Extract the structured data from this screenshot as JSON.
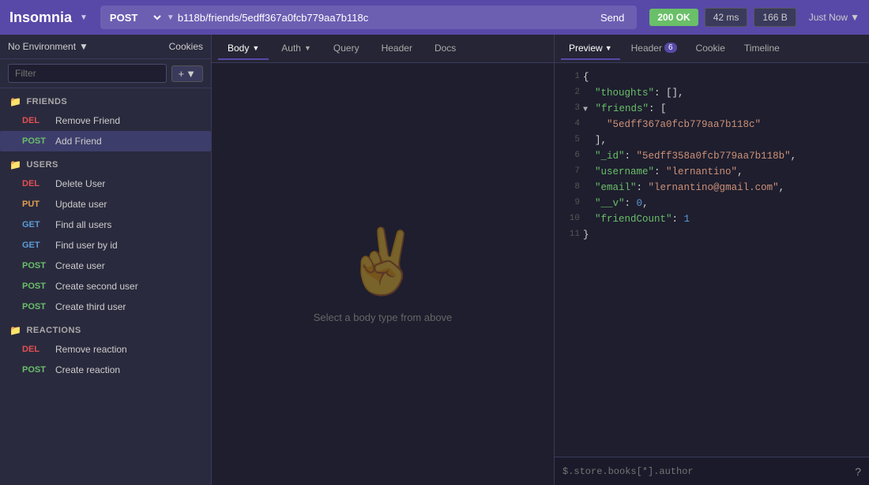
{
  "app": {
    "title": "Insomnia"
  },
  "topbar": {
    "method": "POST",
    "url": "b118b/friends/5edff367a0fcb779aa7b118c",
    "send_label": "Send",
    "status": "200 OK",
    "time": "42 ms",
    "size": "166 B",
    "timestamp": "Just Now"
  },
  "sidebar": {
    "env_label": "No Environment",
    "cookies_label": "Cookies",
    "filter_placeholder": "Filter",
    "add_label": "+",
    "groups": [
      {
        "name": "FRIENDS",
        "items": [
          {
            "method": "DEL",
            "label": "Remove Friend"
          },
          {
            "method": "POST",
            "label": "Add Friend",
            "active": true
          }
        ]
      },
      {
        "name": "USERS",
        "items": [
          {
            "method": "DEL",
            "label": "Delete User"
          },
          {
            "method": "PUT",
            "label": "Update user"
          },
          {
            "method": "GET",
            "label": "Find all users"
          },
          {
            "method": "GET",
            "label": "Find user by id"
          },
          {
            "method": "POST",
            "label": "Create user"
          },
          {
            "method": "POST",
            "label": "Create second user"
          },
          {
            "method": "POST",
            "label": "Create third user"
          }
        ]
      },
      {
        "name": "REACTIONS",
        "items": [
          {
            "method": "DEL",
            "label": "Remove reaction"
          },
          {
            "method": "POST",
            "label": "Create reaction"
          }
        ]
      }
    ]
  },
  "center": {
    "tabs": [
      {
        "label": "Body",
        "active": true,
        "has_arrow": true
      },
      {
        "label": "Auth",
        "has_arrow": true
      },
      {
        "label": "Query"
      },
      {
        "label": "Header"
      },
      {
        "label": "Docs"
      }
    ],
    "body_placeholder": "Select a body type from above"
  },
  "right": {
    "tabs": [
      {
        "label": "Preview",
        "active": true,
        "has_arrow": true
      },
      {
        "label": "Header",
        "badge": "6"
      },
      {
        "label": "Cookie"
      },
      {
        "label": "Timeline"
      }
    ],
    "json": [
      {
        "line": 1,
        "content": "{",
        "type": "brace"
      },
      {
        "line": 2,
        "key": "\"thoughts\"",
        "value": "[]",
        "comma": true
      },
      {
        "line": 3,
        "key": "\"friends\"",
        "value": "[",
        "comma": false,
        "expand": true
      },
      {
        "line": 4,
        "indent": true,
        "value": "\"5edff367a0fcb779aa7b118c\""
      },
      {
        "line": 5,
        "content": "],",
        "indent_close": true
      },
      {
        "line": 6,
        "key": "\"_id\"",
        "value": "\"5edff358a0fcb779aa7b118b\"",
        "comma": true
      },
      {
        "line": 7,
        "key": "\"username\"",
        "value": "\"lernantino\"",
        "comma": true
      },
      {
        "line": 8,
        "key": "\"email\"",
        "value": "\"lernantino@gmail.com\"",
        "comma": true
      },
      {
        "line": 9,
        "key": "\"__v\"",
        "value": "0",
        "comma": true,
        "num": true
      },
      {
        "line": 10,
        "key": "\"friendCount\"",
        "value": "1",
        "comma": false,
        "num": true
      },
      {
        "line": 11,
        "content": "}",
        "type": "brace"
      }
    ],
    "jq_placeholder": "$.store.books[*].author"
  }
}
